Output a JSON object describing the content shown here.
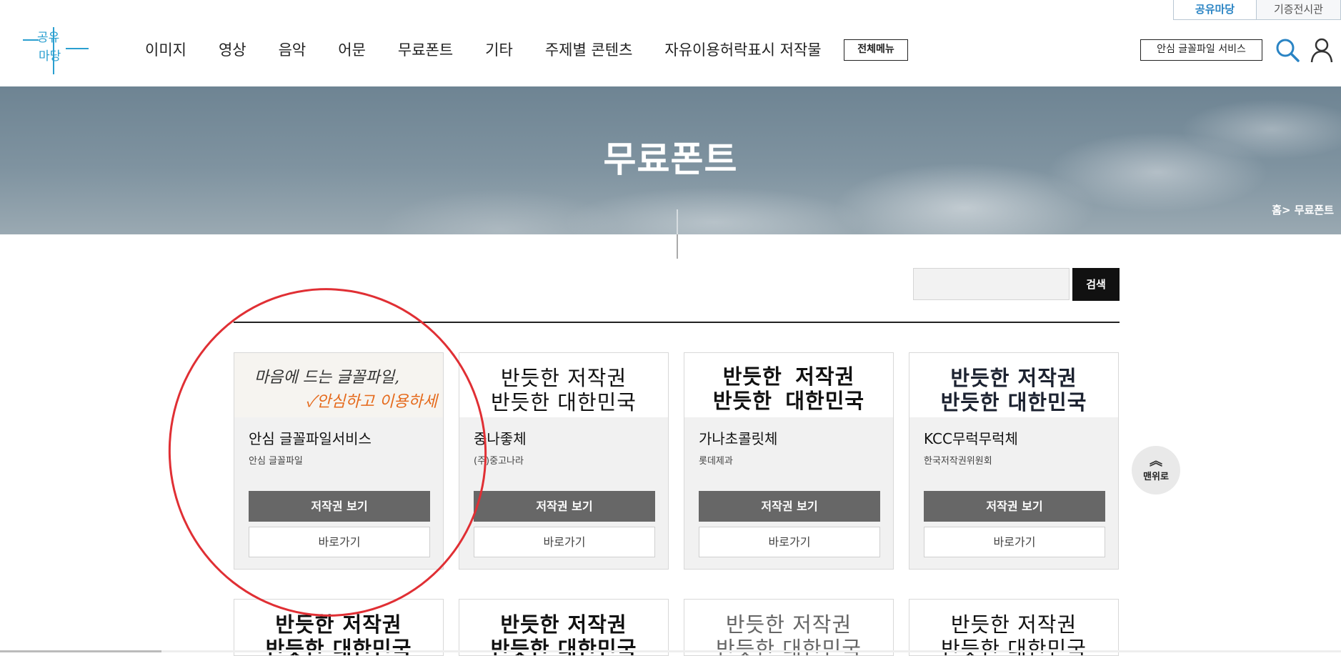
{
  "util_tabs": [
    "공유마당",
    "기증전시관"
  ],
  "logo": {
    "line1": "공유",
    "line2": "마당"
  },
  "nav": [
    "이미지",
    "영상",
    "음악",
    "어문",
    "무료폰트",
    "기타",
    "주제별 콘텐츠",
    "자유이용허락표시 저작물"
  ],
  "all_menu": "전체메뉴",
  "safe_service": "안심 글꼴파일 서비스",
  "hero": {
    "title": "무료폰트",
    "breadcrumb": "홈> 무료폰트"
  },
  "search": {
    "button": "검색",
    "value": ""
  },
  "cards": [
    {
      "name": "안심 글꼴파일서비스",
      "maker": "안심 글꼴파일",
      "thumb": [
        "마음에 드는 글꼴파일,",
        "✓안심하고 이용하세요!"
      ],
      "copy": "저작권 보기",
      "go": "바로가기"
    },
    {
      "name": "중나좋체",
      "maker": "(주)중고나라",
      "thumb": [
        "반듯한 저작권",
        "반듯한 대한민국"
      ],
      "copy": "저작권 보기",
      "go": "바로가기"
    },
    {
      "name": "가나초콜릿체",
      "maker": "롯데제과",
      "thumb": [
        "반듯한 저작권",
        "반듯한 대한민국"
      ],
      "copy": "저작권 보기",
      "go": "바로가기"
    },
    {
      "name": "KCC무럭무럭체",
      "maker": "한국저작권위원회",
      "thumb": [
        "반듯한 저작권",
        "반듯한 대한민국"
      ],
      "copy": "저작권 보기",
      "go": "바로가기"
    }
  ],
  "cards_row2": [
    {
      "thumb": [
        "반듯한 저작권",
        "반듯한 대한민국"
      ]
    },
    {
      "thumb": [
        "반듯한 저작권",
        "반듯한 대한민국"
      ]
    },
    {
      "thumb": [
        "반듯한 저작권",
        "반듯한 대한민국"
      ]
    },
    {
      "thumb": [
        "반듯한 저작권",
        "반듯한 대한민국"
      ]
    }
  ],
  "to_top": "맨위로",
  "colors": {
    "accent": "#2a84c4",
    "annotation": "#e02f34",
    "button_dark": "#676767"
  }
}
